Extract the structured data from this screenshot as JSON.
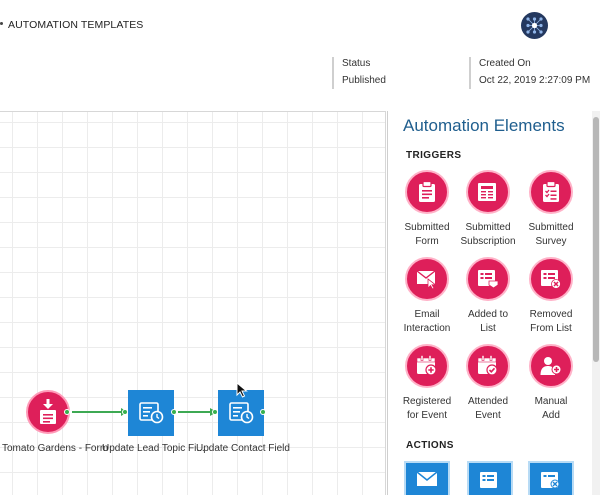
{
  "header": {
    "breadcrumb": "AUTOMATION TEMPLATES",
    "avatar_icon": "network-hub-icon"
  },
  "record": {
    "status_label": "Status",
    "status_value": "Published",
    "created_label": "Created On",
    "created_value": "Oct 22, 2019 2:27:09 PM"
  },
  "canvas": {
    "nodes": [
      {
        "label": "Tomato Gardens - Form",
        "icon": "form-download-icon",
        "kind": "trigger"
      },
      {
        "label": "Update Lead Topic Fi...",
        "icon": "update-field-icon",
        "kind": "action"
      },
      {
        "label": "Update Contact Field",
        "icon": "update-field-icon",
        "kind": "action"
      }
    ]
  },
  "panel": {
    "title": "Automation Elements",
    "triggers_label": "TRIGGERS",
    "actions_label": "ACTIONS",
    "triggers": [
      {
        "line1": "Submitted",
        "line2": "Form",
        "icon": "clipboard-form-icon"
      },
      {
        "line1": "Submitted",
        "line2": "Subscription",
        "icon": "newspaper-icon"
      },
      {
        "line1": "Submitted",
        "line2": "Survey",
        "icon": "checklist-icon"
      },
      {
        "line1": "Email",
        "line2": "Interaction",
        "icon": "email-click-icon"
      },
      {
        "line1": "Added to",
        "line2": "List",
        "icon": "list-add-icon"
      },
      {
        "line1": "Removed",
        "line2": "From List",
        "icon": "list-remove-icon"
      },
      {
        "line1": "Registered",
        "line2": "for Event",
        "icon": "calendar-add-icon"
      },
      {
        "line1": "Attended",
        "line2": "Event",
        "icon": "calendar-check-icon"
      },
      {
        "line1": "Manual",
        "line2": "Add",
        "icon": "person-add-icon"
      }
    ],
    "actions": [
      {
        "icon": "send-email-icon"
      },
      {
        "icon": "add-to-list-icon"
      },
      {
        "icon": "remove-from-list-icon"
      }
    ]
  },
  "colors": {
    "trigger": "#de1f5a",
    "action": "#1e86d6",
    "connector": "#3da953",
    "panel_title": "#1f5e8e"
  }
}
